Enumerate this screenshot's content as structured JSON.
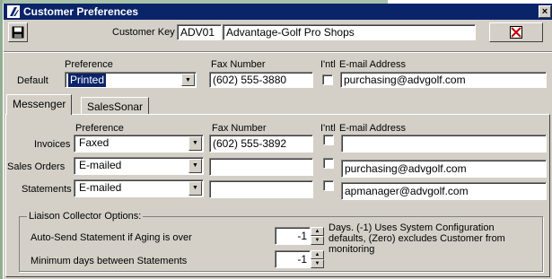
{
  "window": {
    "title": "Customer Preferences",
    "close_glyph": "×"
  },
  "toolbar": {
    "customer_key_label": "Customer Key",
    "customer_key": "ADV01",
    "customer_name": "Advantage-Golf Pro Shops"
  },
  "headers": {
    "preference": "Preference",
    "fax_number": "Fax Number",
    "intl": "I'ntl",
    "email": "E-mail Address"
  },
  "default_row": {
    "label": "Default",
    "preference": "Printed",
    "fax": "(602) 555-3880",
    "intl": false,
    "email": "purchasing@advgolf.com"
  },
  "tabs": [
    {
      "label": "Messenger",
      "active": true
    },
    {
      "label": "SalesSonar",
      "active": false
    }
  ],
  "messenger": {
    "rows": [
      {
        "label": "Invoices",
        "preference": "Faxed",
        "fax": "(602) 555-3892",
        "intl": false,
        "email": ""
      },
      {
        "label": "Sales Orders",
        "preference": "E-mailed",
        "fax": "",
        "intl": false,
        "email": "purchasing@advgolf.com"
      },
      {
        "label": "Statements",
        "preference": "E-mailed",
        "fax": "",
        "intl": false,
        "email": "apmanager@advgolf.com"
      }
    ]
  },
  "liaison": {
    "title": "Liaison Collector Options:",
    "auto_send_label": "Auto-Send Statement if Aging is over",
    "auto_send_value": "-1",
    "min_days_label": "Minimum days between Statements",
    "min_days_value": "-1",
    "description": "Days. (-1) Uses System Configuration defaults, (Zero) excludes Customer from monitoring"
  },
  "icons": {
    "save": "floppy-disk-icon",
    "delete": "delete-record-icon",
    "app": "app-logo-icon"
  }
}
